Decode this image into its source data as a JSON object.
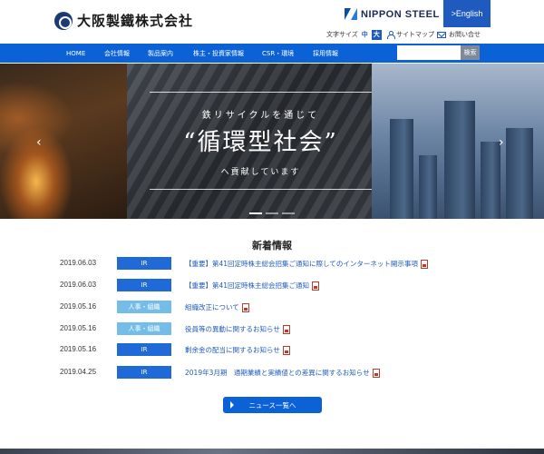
{
  "header": {
    "logo_text": "大阪製鐵株式会社",
    "partner_logo": "NIPPON STEEL",
    "english_label": ">English",
    "font_size_label": "文字サイズ",
    "font_size_mid": "中",
    "font_size_large": "大",
    "sitemap_label": "サイトマップ",
    "contact_label": "お問い合せ"
  },
  "nav": {
    "items": [
      "HOME",
      "会社情報",
      "製品案内",
      "株主・投資家情報",
      "CSR・環境",
      "採用情報"
    ],
    "search_placeholder": "",
    "search_button": "検索"
  },
  "hero": {
    "line1": "鉄リサイクルを通じて",
    "title": "“循環型社会”",
    "line2": "へ貢献しています",
    "arrow_left": "‹",
    "arrow_right": "›"
  },
  "news": {
    "title": "新着情報",
    "items": [
      {
        "date": "2019.06.03",
        "category": "IR",
        "text": "【重要】第41回定時株主総会招集ご通知に際してのインターネット開示事項"
      },
      {
        "date": "2019.06.03",
        "category": "IR",
        "text": "【重要】第41回定時株主総会招集ご通知"
      },
      {
        "date": "2019.05.16",
        "category": "人事・組織",
        "text": "組織改正について"
      },
      {
        "date": "2019.05.16",
        "category": "人事・組織",
        "text": "役員等の異動に関するお知らせ"
      },
      {
        "date": "2019.05.16",
        "category": "IR",
        "text": "剰余金の配当に関するお知らせ"
      },
      {
        "date": "2019.04.25",
        "category": "IR",
        "text": "2019年3月期　通期業績と実績値との差異に関するお知らせ"
      }
    ],
    "more_label": "ニュース一覧へ"
  },
  "colors": {
    "brand_blue": "#0b62d6",
    "ir_badge": "#1f6ad6",
    "hr_badge": "#73bde8"
  }
}
